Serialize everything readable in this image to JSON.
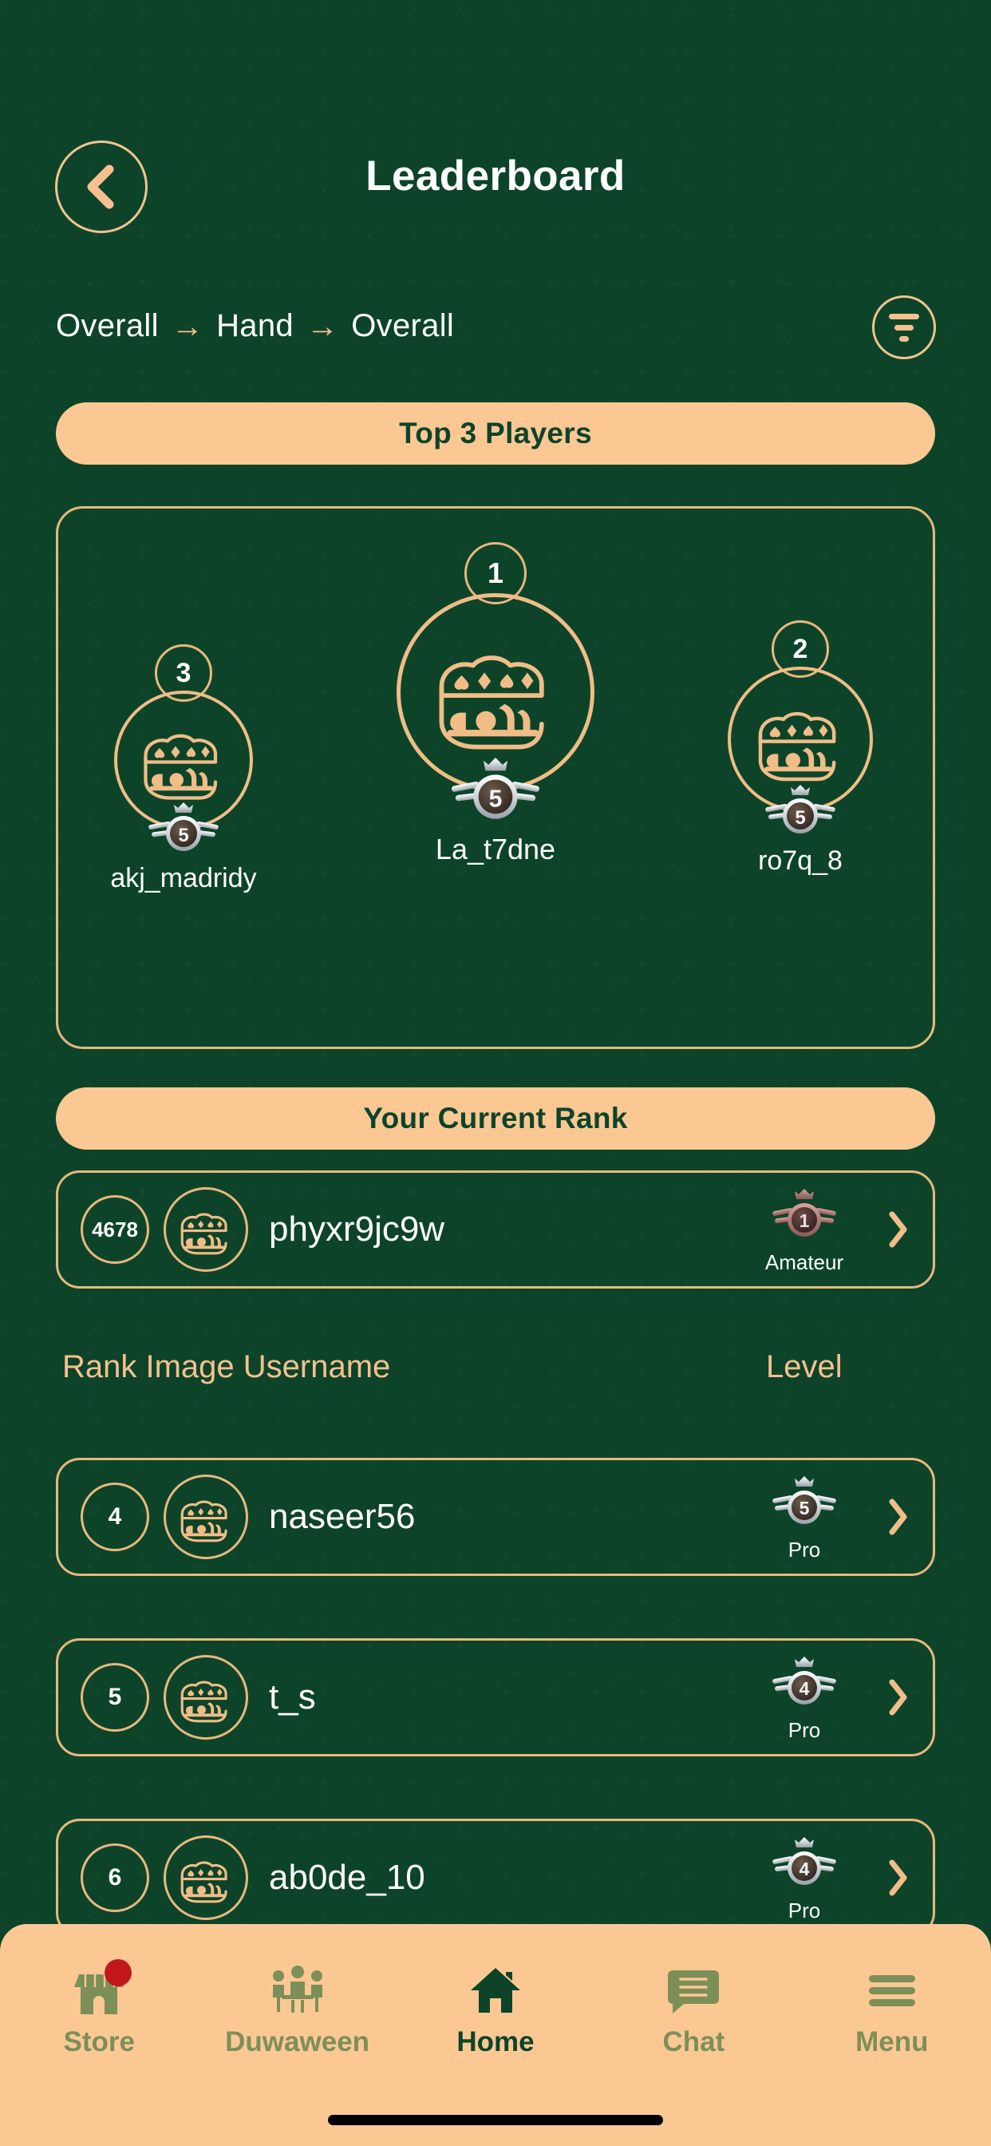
{
  "header": {
    "title": "Leaderboard",
    "back_icon": "chevron-left-icon"
  },
  "breadcrumb": {
    "items": [
      "Overall",
      "Hand",
      "Overall"
    ],
    "separator": "→",
    "filter_icon": "filter-icon"
  },
  "banners": {
    "top3": "Top 3 Players",
    "current_rank": "Your Current Rank"
  },
  "podium": [
    {
      "rank": "3",
      "username": "akj_madridy",
      "level": "5",
      "medal_color": "silver"
    },
    {
      "rank": "1",
      "username": "La_t7dne",
      "level": "5",
      "medal_color": "silver"
    },
    {
      "rank": "2",
      "username": "ro7q_8",
      "level": "5",
      "medal_color": "silver"
    }
  ],
  "current_user": {
    "rank": "4678",
    "username": "phyxr9jc9w",
    "level": "1",
    "level_label": "Amateur",
    "medal_color": "bronze",
    "chevron_icon": "chevron-right-icon"
  },
  "columns": {
    "left": "Rank Image  Username",
    "right": "Level"
  },
  "rows": [
    {
      "rank": "4",
      "username": "naseer56",
      "level": "5",
      "level_label": "Pro",
      "medal_color": "silver",
      "chevron_icon": "chevron-right-icon"
    },
    {
      "rank": "5",
      "username": "t_s",
      "level": "4",
      "level_label": "Pro",
      "medal_color": "silver",
      "chevron_icon": "chevron-right-icon"
    },
    {
      "rank": "6",
      "username": "ab0de_10",
      "level": "4",
      "level_label": "Pro",
      "medal_color": "silver",
      "chevron_icon": "chevron-right-icon"
    }
  ],
  "bottom_nav": [
    {
      "label": "Store",
      "icon": "store-icon",
      "active": false,
      "badge": true
    },
    {
      "label": "Duwaween",
      "icon": "people-table-icon",
      "active": false,
      "badge": false
    },
    {
      "label": "Home",
      "icon": "home-icon",
      "active": true,
      "badge": false
    },
    {
      "label": "Chat",
      "icon": "chat-bubble-icon",
      "active": false,
      "badge": false
    },
    {
      "label": "Menu",
      "icon": "hamburger-menu-icon",
      "active": false,
      "badge": false
    }
  ],
  "colors": {
    "background": "#0d4429",
    "accent_peach": "#fbc894",
    "border_gold": "#e8b87f",
    "text_white": "#ffffff",
    "nav_inactive": "#7d8f58",
    "badge_red": "#c2171c"
  }
}
